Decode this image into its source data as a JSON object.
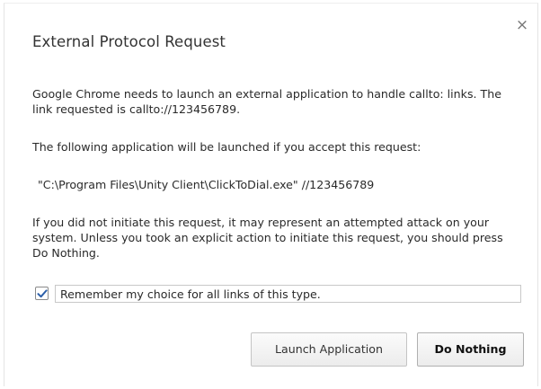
{
  "dialog": {
    "title": "External Protocol Request",
    "close_icon": "close-icon",
    "paragraphs": [
      "Google Chrome needs to launch an external application to handle callto: links. The link requested is callto://123456789.",
      "The following application will be launched if you accept this request:",
      "\"C:\\Program Files\\Unity Client\\ClickToDial.exe\" //123456789",
      "If you did not initiate this request, it may represent an attempted attack on your system. Unless you took an explicit action to initiate this request, you should press Do Nothing."
    ],
    "remember": {
      "label": "Remember my choice for all links of this type.",
      "checked": true
    },
    "buttons": {
      "launch": "Launch Application",
      "nothing": "Do Nothing"
    }
  },
  "colors": {
    "check": "#2b5ea8",
    "text": "#2a2a2a"
  }
}
